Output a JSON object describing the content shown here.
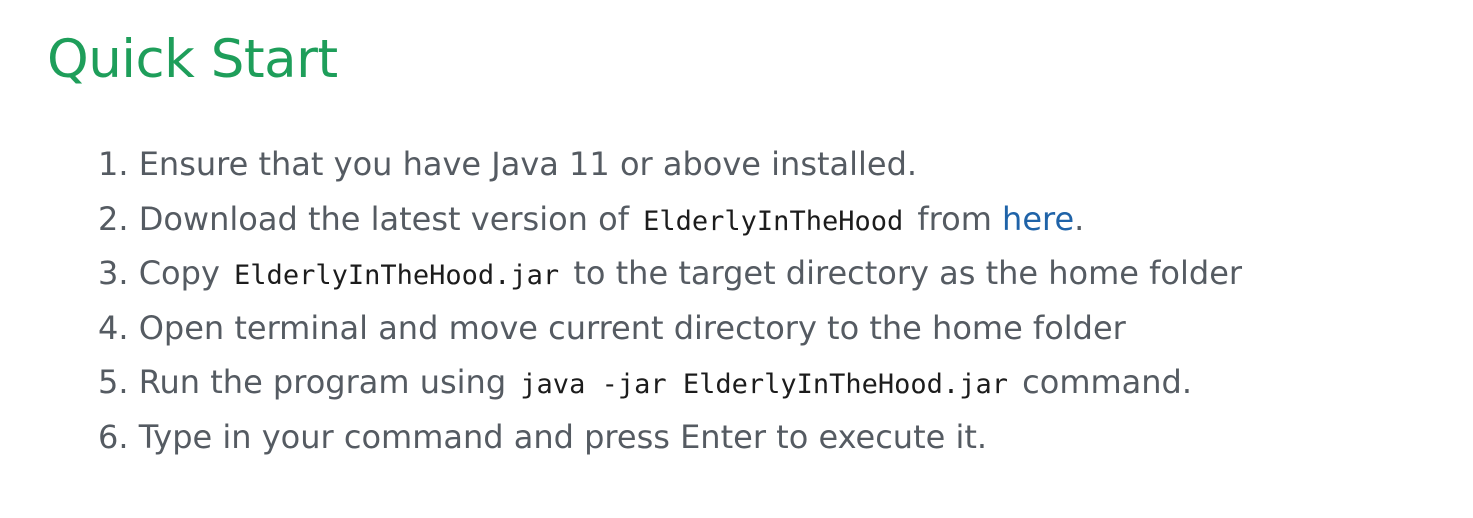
{
  "heading": "Quick Start",
  "steps": [
    {
      "num": "1.",
      "text": "Ensure that you have Java 11 or above installed."
    },
    {
      "num": "2.",
      "pre": "Download the latest version of",
      "code": "ElderlyInTheHood",
      "mid": "from",
      "link": "here",
      "post": "."
    },
    {
      "num": "3.",
      "pre": "Copy",
      "code": "ElderlyInTheHood.jar",
      "post": "to the target directory as the home folder"
    },
    {
      "num": "4.",
      "text": "Open terminal and move current directory to the home folder"
    },
    {
      "num": "5.",
      "pre": "Run the program using",
      "code": "java -jar ElderlyInTheHood.jar",
      "post": "command."
    },
    {
      "num": "6.",
      "text": "Type in your command and press Enter to execute it."
    }
  ],
  "colors": {
    "heading": "#1e9e5a",
    "body_text": "#555b62",
    "link": "#1f63a8",
    "code_text": "#1c1c1c"
  }
}
